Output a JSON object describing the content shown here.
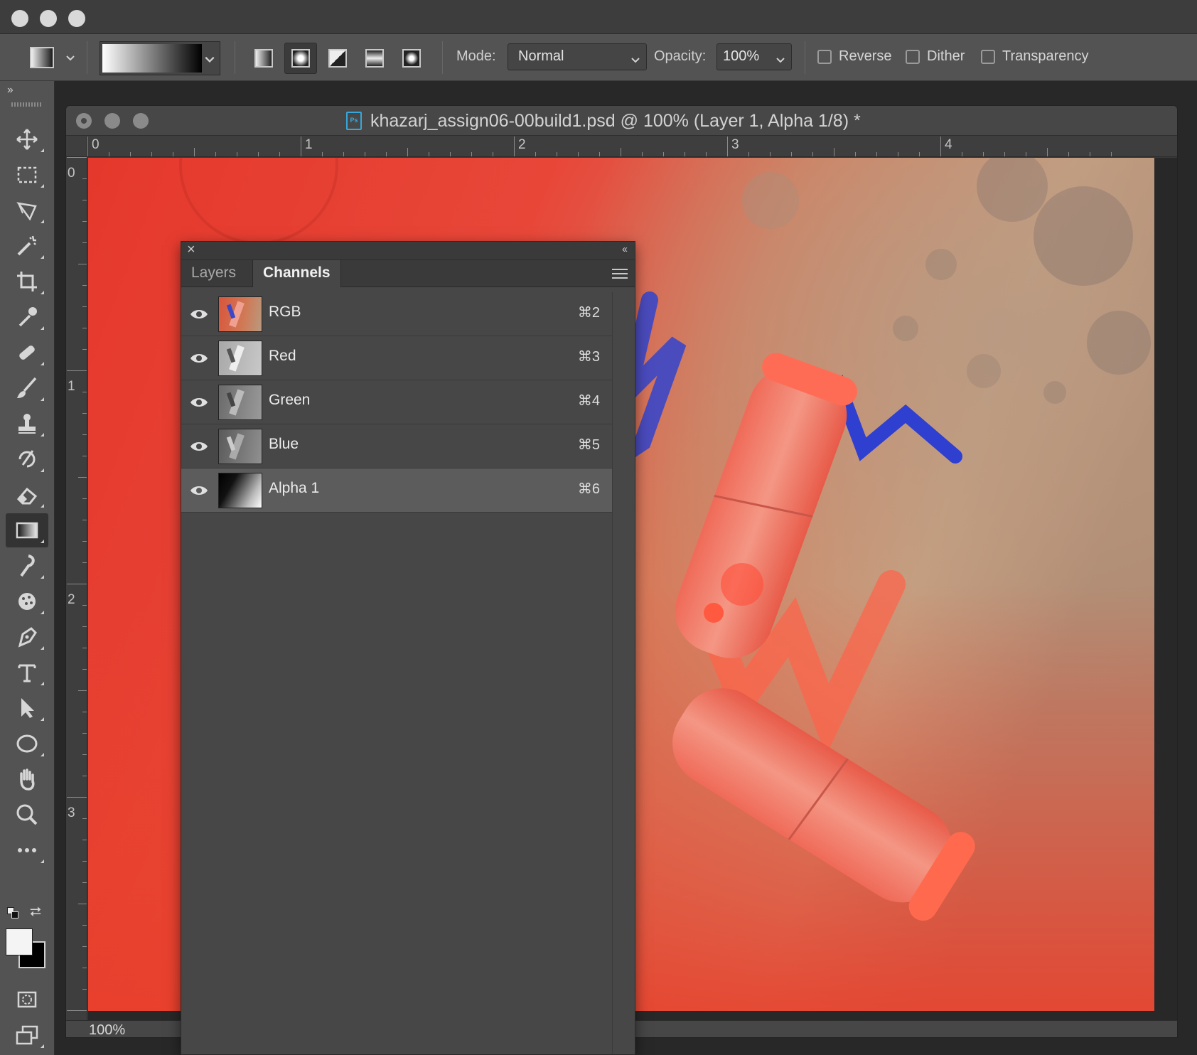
{
  "window": {
    "title_dots": [
      "close",
      "minimize",
      "zoom"
    ]
  },
  "options_bar": {
    "mode_label": "Mode:",
    "mode_value": "Normal",
    "opacity_label": "Opacity:",
    "opacity_value": "100%",
    "reverse_label": "Reverse",
    "dither_label": "Dither",
    "transparency_label": "Transparency",
    "gradient_types": [
      "linear",
      "radial",
      "angle",
      "reflected",
      "diamond"
    ],
    "active_gradient_type": "radial"
  },
  "toolbar": {
    "collapse_glyph": "››",
    "tools": [
      "move-tool",
      "marquee-tool",
      "lasso-tool",
      "magic-wand-tool",
      "crop-tool",
      "eyedropper-tool",
      "healing-brush-tool",
      "brush-tool",
      "clone-stamp-tool",
      "history-brush-tool",
      "eraser-tool",
      "gradient-tool",
      "smudge-tool",
      "sponge-tool",
      "pen-tool",
      "type-tool",
      "path-selection-tool",
      "ellipse-tool",
      "hand-tool",
      "zoom-tool",
      "more-tools"
    ],
    "active_tool": "gradient-tool",
    "foreground_color": "#f4f4f4",
    "background_color": "#000000"
  },
  "document": {
    "filename": "khazarj_assign06-00build1.psd @ 100% (Layer 1, Alpha 1/8) *",
    "ruler_h_labels": [
      "0",
      "1",
      "2",
      "3",
      "4"
    ],
    "ruler_v_labels": [
      "0",
      "1",
      "2",
      "3"
    ],
    "zoom": "100%"
  },
  "channels_panel": {
    "close_glyph": "×",
    "collapse_glyph": "‹‹",
    "tabs": [
      {
        "label": "Layers",
        "active": false
      },
      {
        "label": "Channels",
        "active": true
      }
    ],
    "channels": [
      {
        "name": "RGB",
        "shortcut": "⌘2",
        "visible": true,
        "selected": false
      },
      {
        "name": "Red",
        "shortcut": "⌘3",
        "visible": true,
        "selected": false
      },
      {
        "name": "Green",
        "shortcut": "⌘4",
        "visible": true,
        "selected": false
      },
      {
        "name": "Blue",
        "shortcut": "⌘5",
        "visible": true,
        "selected": false
      },
      {
        "name": "Alpha 1",
        "shortcut": "⌘6",
        "visible": true,
        "selected": true
      }
    ]
  },
  "colors": {
    "ui_dark": "#535353",
    "canvas_red": "#e83a2e",
    "pastel_orange": "#ff6a4a",
    "pastel_blue": "#2c3ed0"
  }
}
